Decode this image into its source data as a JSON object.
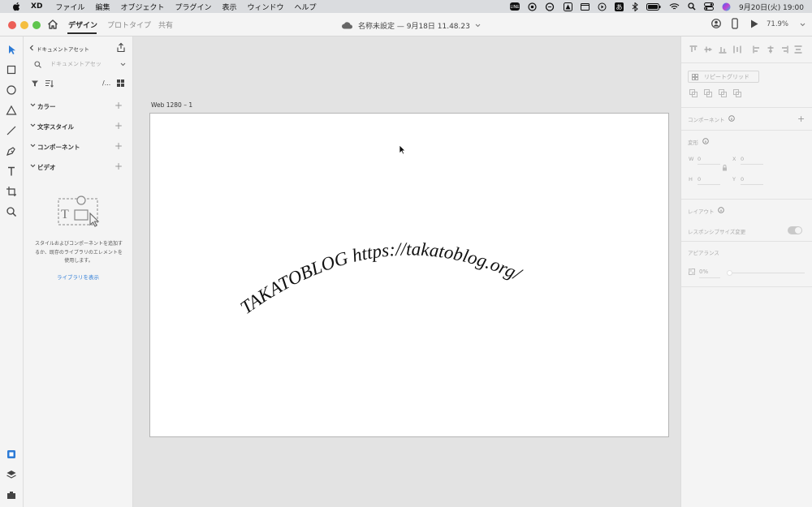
{
  "menubar": {
    "app_name": "XD",
    "menus": [
      "ファイル",
      "編集",
      "オブジェクト",
      "プラグイン",
      "表示",
      "ウィンドウ",
      "ヘルプ"
    ],
    "clock": "9月20日(火)  19:00"
  },
  "titlebar": {
    "tabs": [
      "デザイン",
      "プロトタイプ",
      "共有"
    ],
    "doc_title": "名称未設定 — 9月18日 11.48.23",
    "zoom": "71.9%"
  },
  "assets": {
    "header": "ドキュメントアセット",
    "search_placeholder": "ドキュメントアセッ",
    "filter_label": "/...",
    "sections": [
      "カラー",
      "文字スタイル",
      "コンポーネント",
      "ビデオ"
    ],
    "empty_text": [
      "スタイルおよびコンポーネントを追加す",
      "るか、既存のライブラリのエレメントを",
      "使用します。"
    ],
    "library_link": "ライブラリを表示"
  },
  "canvas": {
    "artboard_name": "Web 1280 – 1",
    "arc_text": "TAKATOBLOG  https://takatoblog.org/"
  },
  "props": {
    "repeat_grid": "リピートグリッド",
    "component_label": "コンポーネント",
    "transform_label": "変形",
    "w_label": "W",
    "w_value": "0",
    "x_label": "X",
    "x_value": "0",
    "h_label": "H",
    "h_value": "0",
    "y_label": "Y",
    "y_value": "0",
    "layout_label": "レイアウト",
    "responsive_label": "レスポンシブサイズ変更",
    "appearance_label": "アピアランス",
    "opacity_value": "0%"
  },
  "colors": {
    "link": "#2d7bd6",
    "canvas": "#e3e3e3",
    "panel": "#f4f4f4"
  }
}
